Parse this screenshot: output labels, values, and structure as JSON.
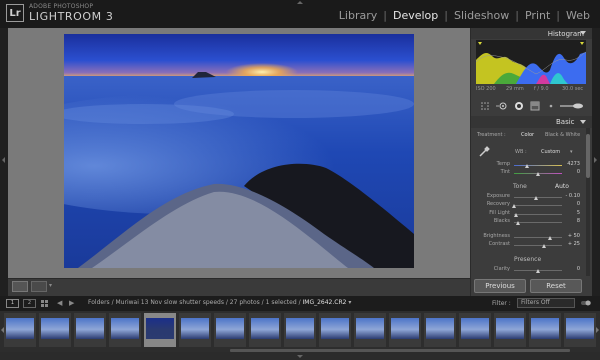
{
  "app": {
    "logo": "Lr",
    "brand_top": "ADOBE PHOTOSHOP",
    "brand_main": "LIGHTROOM 3",
    "modules": [
      {
        "label": "Library",
        "active": false
      },
      {
        "label": "Develop",
        "active": true
      },
      {
        "label": "Slideshow",
        "active": false
      },
      {
        "label": "Print",
        "active": false
      },
      {
        "label": "Web",
        "active": false
      }
    ]
  },
  "histogram": {
    "title": "Histogram",
    "info": {
      "iso": "ISO 200",
      "focal": "29 mm",
      "aperture": "f / 9.0",
      "shutter": "30.0 sec"
    }
  },
  "basic": {
    "title": "Basic",
    "treatment_label": "Treatment :",
    "color_label": "Color",
    "bw_label": "Black & White",
    "wb_label": "WB :",
    "wb_value": "Custom",
    "temp": {
      "label": "Temp",
      "value": "4273",
      "pos": 0.28
    },
    "tint": {
      "label": "Tint",
      "value": "0",
      "pos": 0.5
    },
    "tone_label": "Tone",
    "auto_label": "Auto",
    "exposure": {
      "label": "Exposure",
      "value": "- 0.10",
      "pos": 0.47
    },
    "recovery": {
      "label": "Recovery",
      "value": "0",
      "pos": 0.0
    },
    "fill_light": {
      "label": "Fill Light",
      "value": "5",
      "pos": 0.05
    },
    "blacks": {
      "label": "Blacks",
      "value": "8",
      "pos": 0.08
    },
    "brightness": {
      "label": "Brightness",
      "value": "+ 50",
      "pos": 0.75
    },
    "contrast": {
      "label": "Contrast",
      "value": "+ 25",
      "pos": 0.62
    },
    "presence_label": "Presence",
    "clarity": {
      "label": "Clarity",
      "value": "0",
      "pos": 0.5
    }
  },
  "buttons": {
    "previous": "Previous",
    "reset": "Reset"
  },
  "filmstrip_bar": {
    "btn1": "1",
    "btn2": "2",
    "path": "Folders / Muriwai 13 Nov slow shutter speeds / 27 photos / 1 selected / ",
    "file": "IMG_2642.CR2",
    "filter_label": "Filter :",
    "filter_value": "Filters Off"
  },
  "filmstrip": {
    "count": 17,
    "selected_index": 4
  },
  "colors": {
    "accent": "#e6e6e6",
    "panel": "#3c3c3c",
    "sky": "#2a4db8"
  }
}
